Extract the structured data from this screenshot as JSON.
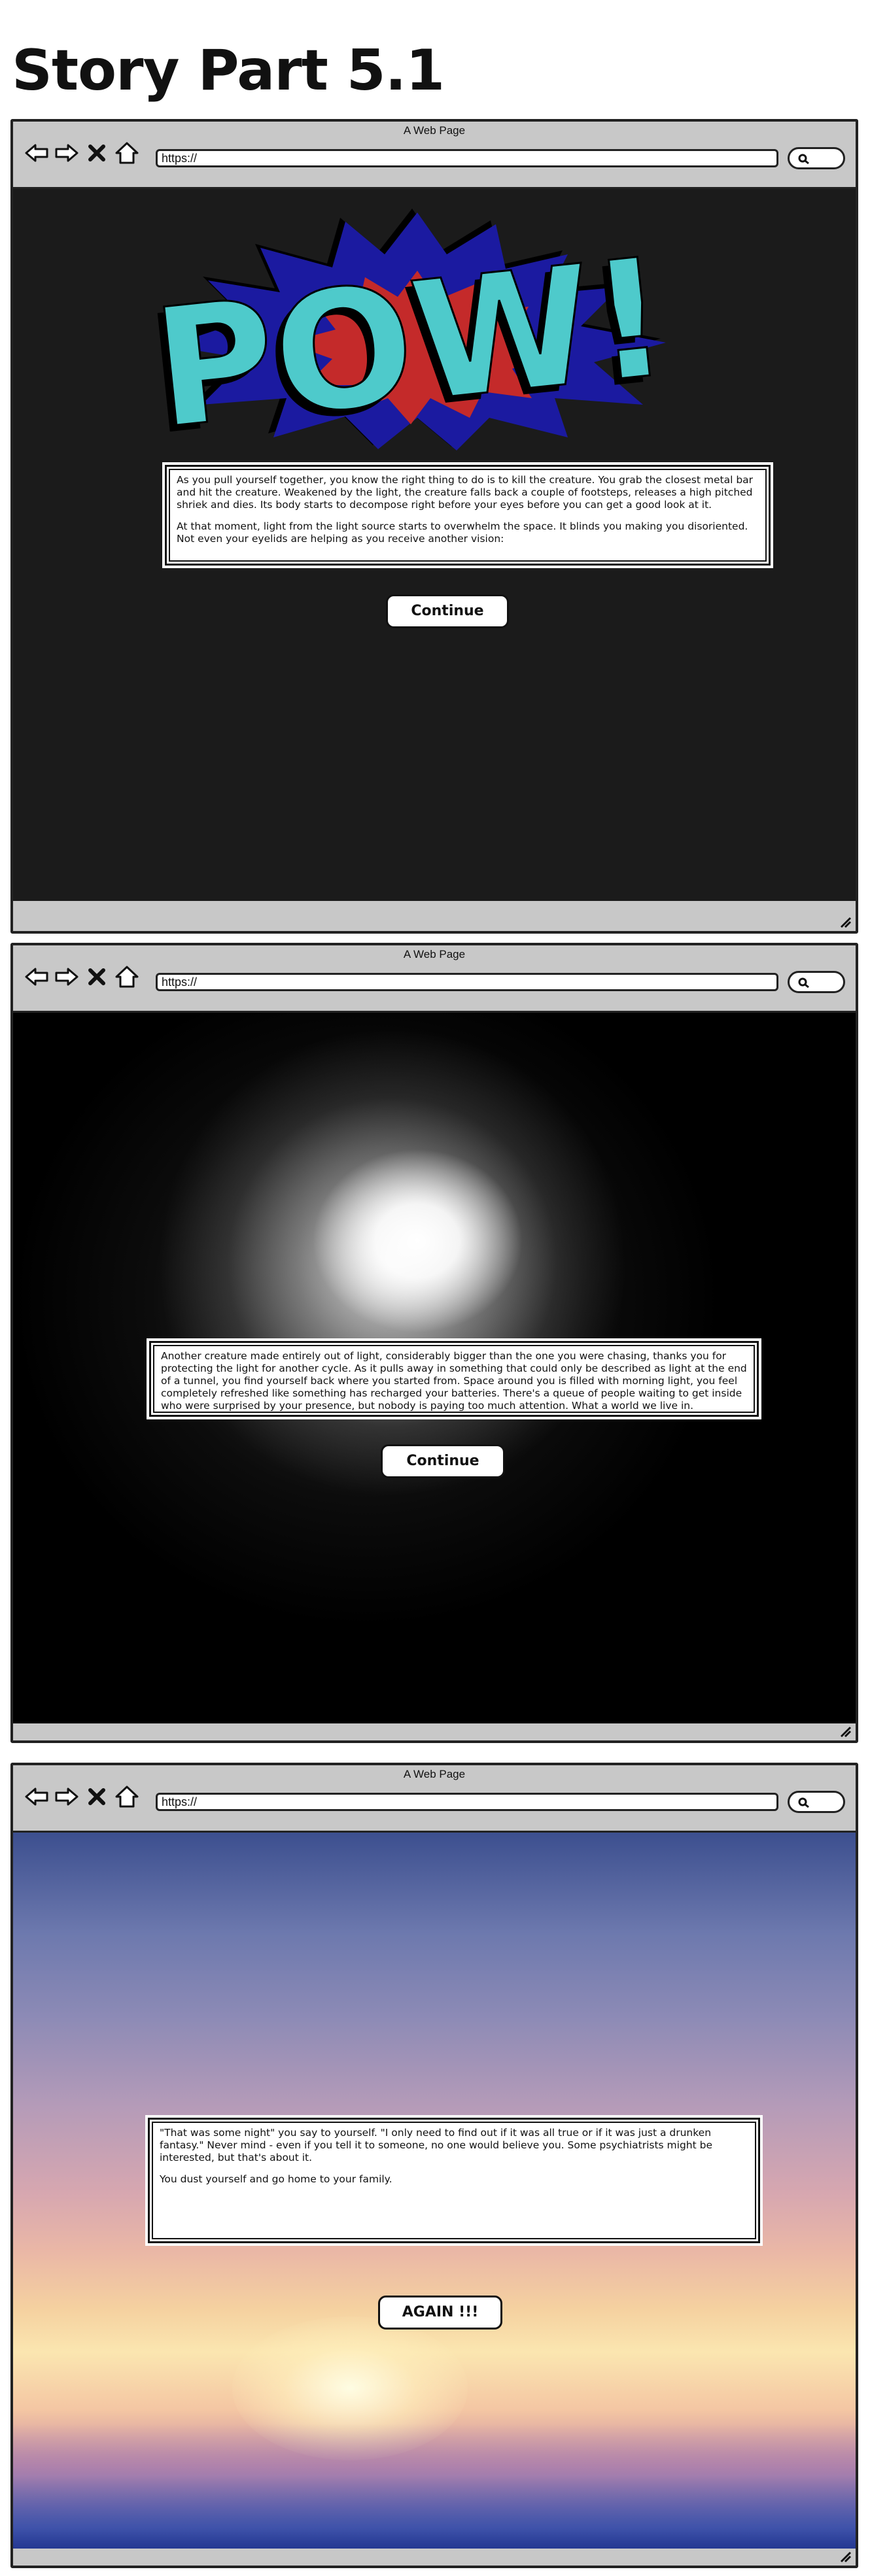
{
  "page": {
    "title": "Story Part 5.1"
  },
  "browser": {
    "window_title": "A Web Page",
    "url": "https://",
    "nav_icons": [
      "back-arrow-icon",
      "forward-arrow-icon",
      "close-x-icon",
      "home-icon"
    ],
    "search_icon": "search-icon"
  },
  "panel1": {
    "banner_text": "POW!",
    "paragraphs": [
      "As you pull yourself together, you know the right thing to do is to kill the creature. You grab the closest metal bar and hit the creature. Weakened by the light, the creature falls back a couple of footsteps, releases a high pitched shriek and dies. Its body starts to decompose right before your eyes before you can get a good look at it.",
      "At that moment, light from the light source starts to overwhelm the space. It blinds you making you disoriented. Not even your eyelids are helping as you receive another vision:"
    ],
    "button_label": "Continue",
    "colors": {
      "burst_outer": "#1b1aa0",
      "burst_inner": "#c42a2a",
      "letters": "#4ecacb"
    }
  },
  "panel2": {
    "paragraphs": [
      "Another creature made entirely out of light, considerably bigger than the one you were chasing, thanks you for protecting the light for another cycle. As it pulls away in something that could only be described as light at the end of a tunnel, you find yourself back where you started from. Space around you is filled with morning light, you feel completely refreshed like something has recharged your batteries. There's a queue of people waiting to get inside who were surprised by your presence, but nobody is paying too much attention. What a world we live in."
    ],
    "button_label": "Continue"
  },
  "panel3": {
    "paragraphs": [
      "\"That was some night\" you say to yourself. \"I only need to find out if it was all true or if it was just a drunken fantasy.\" Never mind - even if you tell it to someone, no one would believe you. Some psychiatrists might be interested, but that's about it.",
      "You dust yourself and go home to your family."
    ],
    "button_label": "AGAIN !!!"
  }
}
